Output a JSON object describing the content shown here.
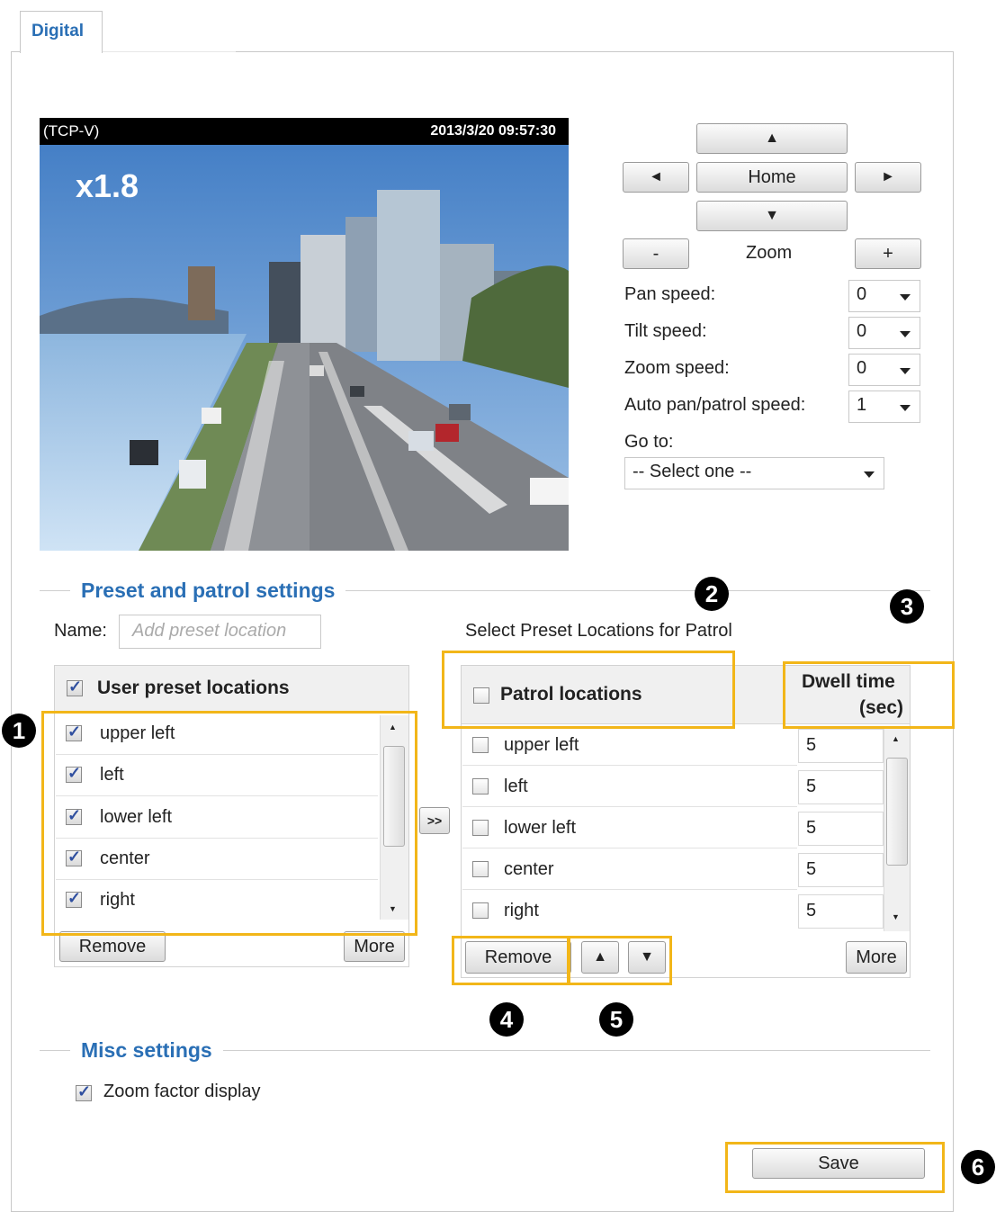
{
  "tab": {
    "label": "Digital"
  },
  "video": {
    "protocol": "(TCP-V)",
    "timestamp": "2013/3/20 09:57:30",
    "zoom_factor": "x1.8"
  },
  "ptz": {
    "up": "▲",
    "down": "▼",
    "left": "◄",
    "right": "►",
    "home": "Home",
    "zoom_label": "Zoom",
    "zoom_out": "-",
    "zoom_in": "+",
    "pan_speed_label": "Pan speed:",
    "pan_speed_value": "0",
    "tilt_speed_label": "Tilt speed:",
    "tilt_speed_value": "0",
    "zoom_speed_label": "Zoom speed:",
    "zoom_speed_value": "0",
    "auto_speed_label": "Auto pan/patrol speed:",
    "auto_speed_value": "1",
    "goto_label": "Go to:",
    "goto_value": "-- Select one --"
  },
  "preset": {
    "section_title": "Preset and patrol settings",
    "name_label": "Name:",
    "name_placeholder": "Add preset location",
    "patrol_caption": "Select Preset Locations for Patrol",
    "user_list_title": "User preset locations",
    "user_items": [
      "upper left",
      "left",
      "lower left",
      "center",
      "right"
    ],
    "add_button": ">>",
    "remove_button": "Remove",
    "more_button": "More",
    "patrol_title": "Patrol locations",
    "dwell_title_1": "Dwell time",
    "dwell_title_2": "(sec)",
    "patrol_items": [
      "upper left",
      "left",
      "lower left",
      "center",
      "right"
    ],
    "dwell_values": [
      "5",
      "5",
      "5",
      "5",
      "5"
    ],
    "patrol_remove": "Remove",
    "move_up": "▲",
    "move_down": "▼",
    "patrol_more": "More"
  },
  "misc": {
    "section_title": "Misc settings",
    "zoom_factor_label": "Zoom factor display"
  },
  "save_button": "Save",
  "callouts": [
    "1",
    "2",
    "3",
    "4",
    "5",
    "6"
  ],
  "colors": {
    "highlight": "#f2b619",
    "link_blue": "#2a6fb5"
  }
}
